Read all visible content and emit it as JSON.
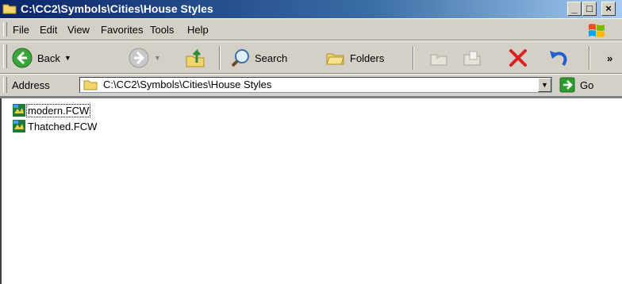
{
  "window": {
    "title": "C:\\CC2\\Symbols\\Cities\\House Styles",
    "controls": {
      "minimize": "_",
      "maximize": "□",
      "close": "×"
    }
  },
  "menubar": {
    "items": [
      {
        "label": "File"
      },
      {
        "label": "Edit"
      },
      {
        "label": "View"
      },
      {
        "label": "Favorites"
      },
      {
        "label": "Tools"
      },
      {
        "label": "Help"
      }
    ]
  },
  "toolbar": {
    "back_label": "Back",
    "search_label": "Search",
    "folders_label": "Folders",
    "overflow": "»"
  },
  "address": {
    "label": "Address",
    "value": "C:\\CC2\\Symbols\\Cities\\House Styles",
    "go_label": "Go"
  },
  "files": [
    {
      "name": "modern.FCW",
      "selected": true
    },
    {
      "name": "Thatched.FCW",
      "selected": false
    }
  ]
}
